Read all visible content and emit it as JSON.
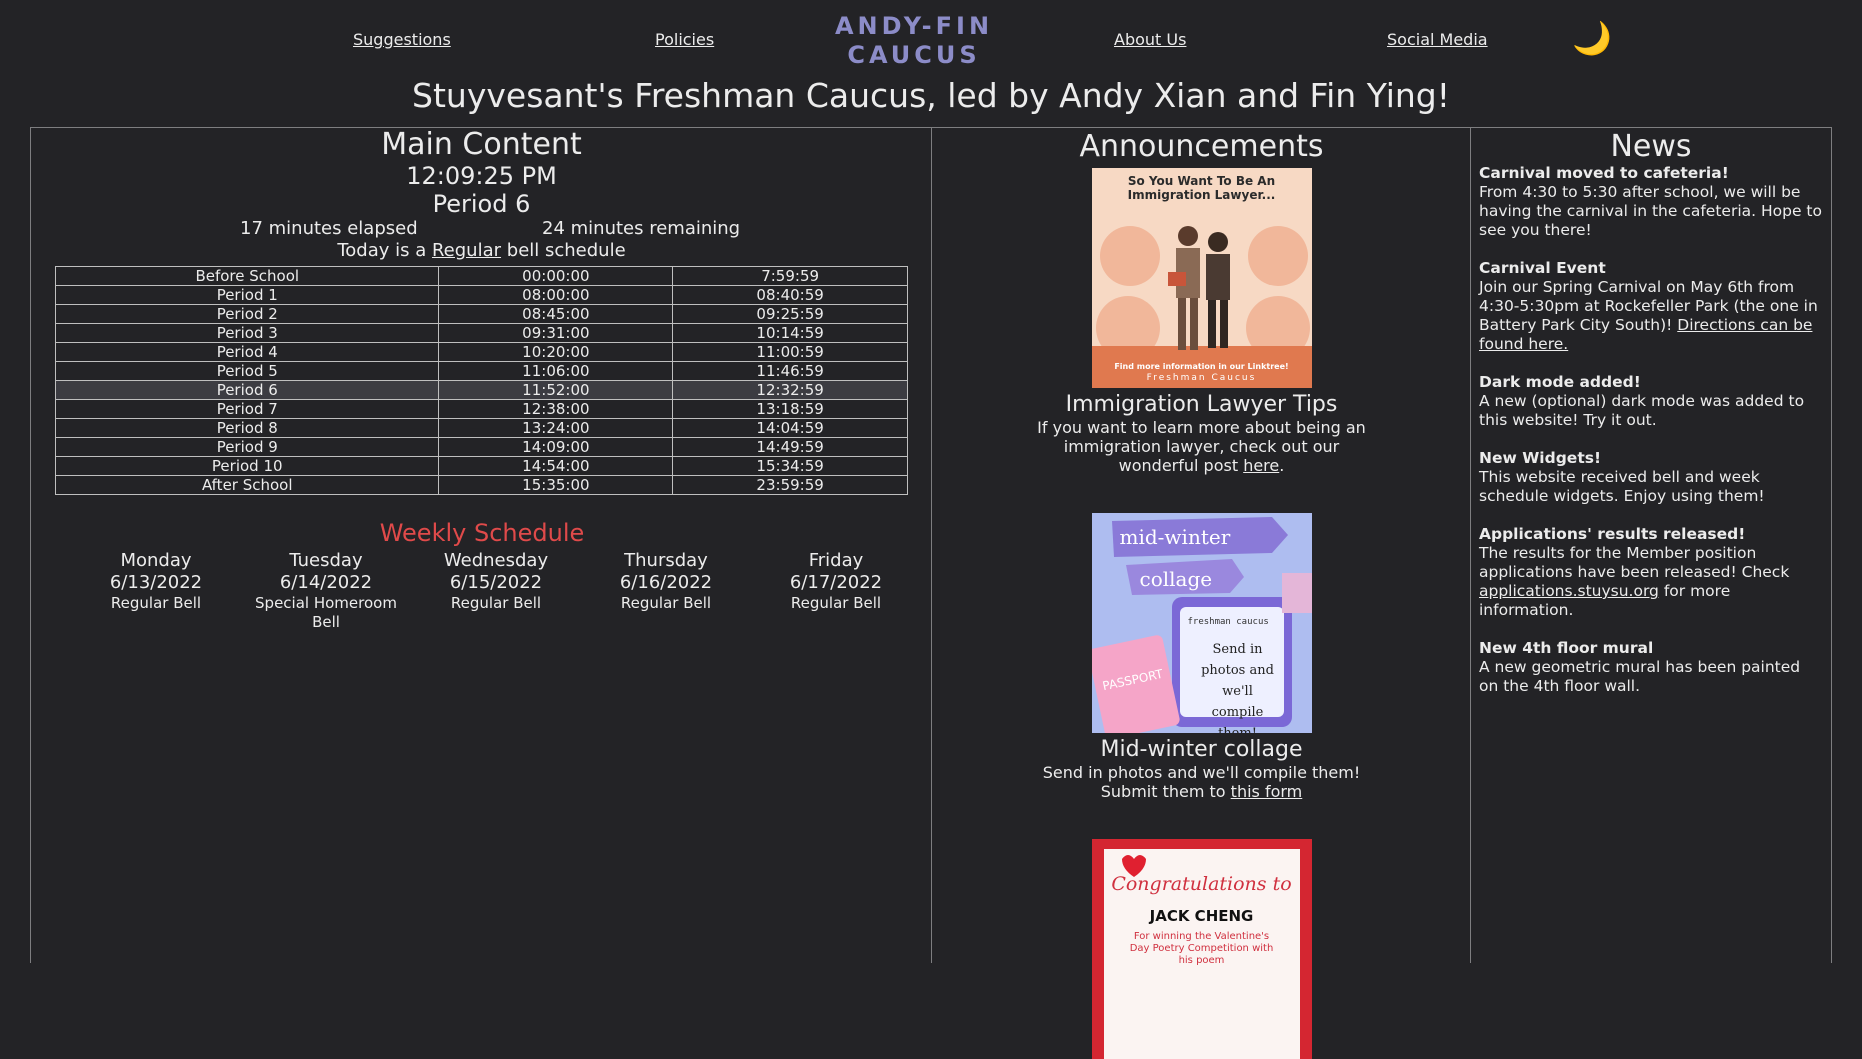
{
  "nav": {
    "suggestions": "Suggestions",
    "policies": "Policies",
    "brand_line1": "ANDY-FIN",
    "brand_line2": "CAUCUS",
    "about": "About Us",
    "social": "Social Media",
    "dark_mode_icon": "🌙"
  },
  "headline": "Stuyvesant's Freshman Caucus, led by Andy Xian and Fin Ying!",
  "main": {
    "title": "Main Content",
    "time": "12:09:25 PM",
    "period": "Period 6",
    "elapsed": "17 minutes elapsed",
    "remaining": "24 minutes remaining",
    "today_prefix": "Today is a",
    "today_schedule": "Regular",
    "today_suffix": "bell schedule",
    "bell_rows": [
      {
        "name": "Before School",
        "start": "00:00:00",
        "end": "7:59:59"
      },
      {
        "name": "Period 1",
        "start": "08:00:00",
        "end": "08:40:59"
      },
      {
        "name": "Period 2",
        "start": "08:45:00",
        "end": "09:25:59"
      },
      {
        "name": "Period 3",
        "start": "09:31:00",
        "end": "10:14:59"
      },
      {
        "name": "Period 4",
        "start": "10:20:00",
        "end": "11:00:59"
      },
      {
        "name": "Period 5",
        "start": "11:06:00",
        "end": "11:46:59"
      },
      {
        "name": "Period 6",
        "start": "11:52:00",
        "end": "12:32:59"
      },
      {
        "name": "Period 7",
        "start": "12:38:00",
        "end": "13:18:59"
      },
      {
        "name": "Period 8",
        "start": "13:24:00",
        "end": "14:04:59"
      },
      {
        "name": "Period 9",
        "start": "14:09:00",
        "end": "14:49:59"
      },
      {
        "name": "Period 10",
        "start": "14:54:00",
        "end": "15:34:59"
      },
      {
        "name": "After School",
        "start": "15:35:00",
        "end": "23:59:59"
      }
    ],
    "current_row": 6,
    "weekly_title": "Weekly Schedule",
    "weekly_color": "#e04a4a",
    "days": [
      {
        "day": "Monday",
        "date": "6/13/2022",
        "bell": "Regular Bell"
      },
      {
        "day": "Tuesday",
        "date": "6/14/2022",
        "bell": "Special Homeroom Bell"
      },
      {
        "day": "Wednesday",
        "date": "6/15/2022",
        "bell": "Regular Bell"
      },
      {
        "day": "Thursday",
        "date": "6/16/2022",
        "bell": "Regular Bell"
      },
      {
        "day": "Friday",
        "date": "6/17/2022",
        "bell": "Regular Bell"
      }
    ]
  },
  "announcements": {
    "title": "Announcements",
    "items": [
      {
        "poster_heading": "So You Want To Be An Immigration Lawyer...",
        "poster_footer": "Find more information in our Linktree!",
        "poster_sign": "Freshman Caucus",
        "title": "Immigration Lawyer Tips",
        "text": "If you want to learn more about being an immigration lawyer, check out our wonderful post",
        "link": "here",
        "after": "."
      },
      {
        "poster_line1": "mid-winter",
        "poster_line2": "collage",
        "poster_tag": "freshman caucus",
        "poster_text": "Send in photos and we'll compile them!",
        "poster_passport": "PASSPORT",
        "title": "Mid-winter collage",
        "text": "Send in photos and we'll compile them! Submit them to",
        "link": "this form",
        "after": ""
      },
      {
        "poster_script": "Congratulations to",
        "poster_name": "JACK CHENG",
        "poster_text": "For winning the Valentine's Day Poetry Competition with his poem"
      }
    ]
  },
  "news": {
    "title": "News",
    "items": [
      {
        "head": "Carnival moved to cafeteria!",
        "body": "From 4:30 to 5:30 after school, we will be having the carnival in the cafeteria. Hope to see you there!"
      },
      {
        "head": "Carnival Event",
        "body": "Join our Spring Carnival on May 6th from 4:30-5:30pm at Rockefeller Park (the one in Battery Park City South)!",
        "link": "Directions can be found here."
      },
      {
        "head": "Dark mode added!",
        "body": "A new (optional) dark mode was added to this website! Try it out."
      },
      {
        "head": "New Widgets!",
        "body": "This website received bell and week schedule widgets. Enjoy using them!"
      },
      {
        "head": "Applications' results released!",
        "body": "The results for the Member position applications have been released! Check",
        "link": "applications.stuysu.org",
        "after": "for more information."
      },
      {
        "head": "New 4th floor mural",
        "body": "A new geometric mural has been painted on the 4th floor wall."
      }
    ]
  }
}
